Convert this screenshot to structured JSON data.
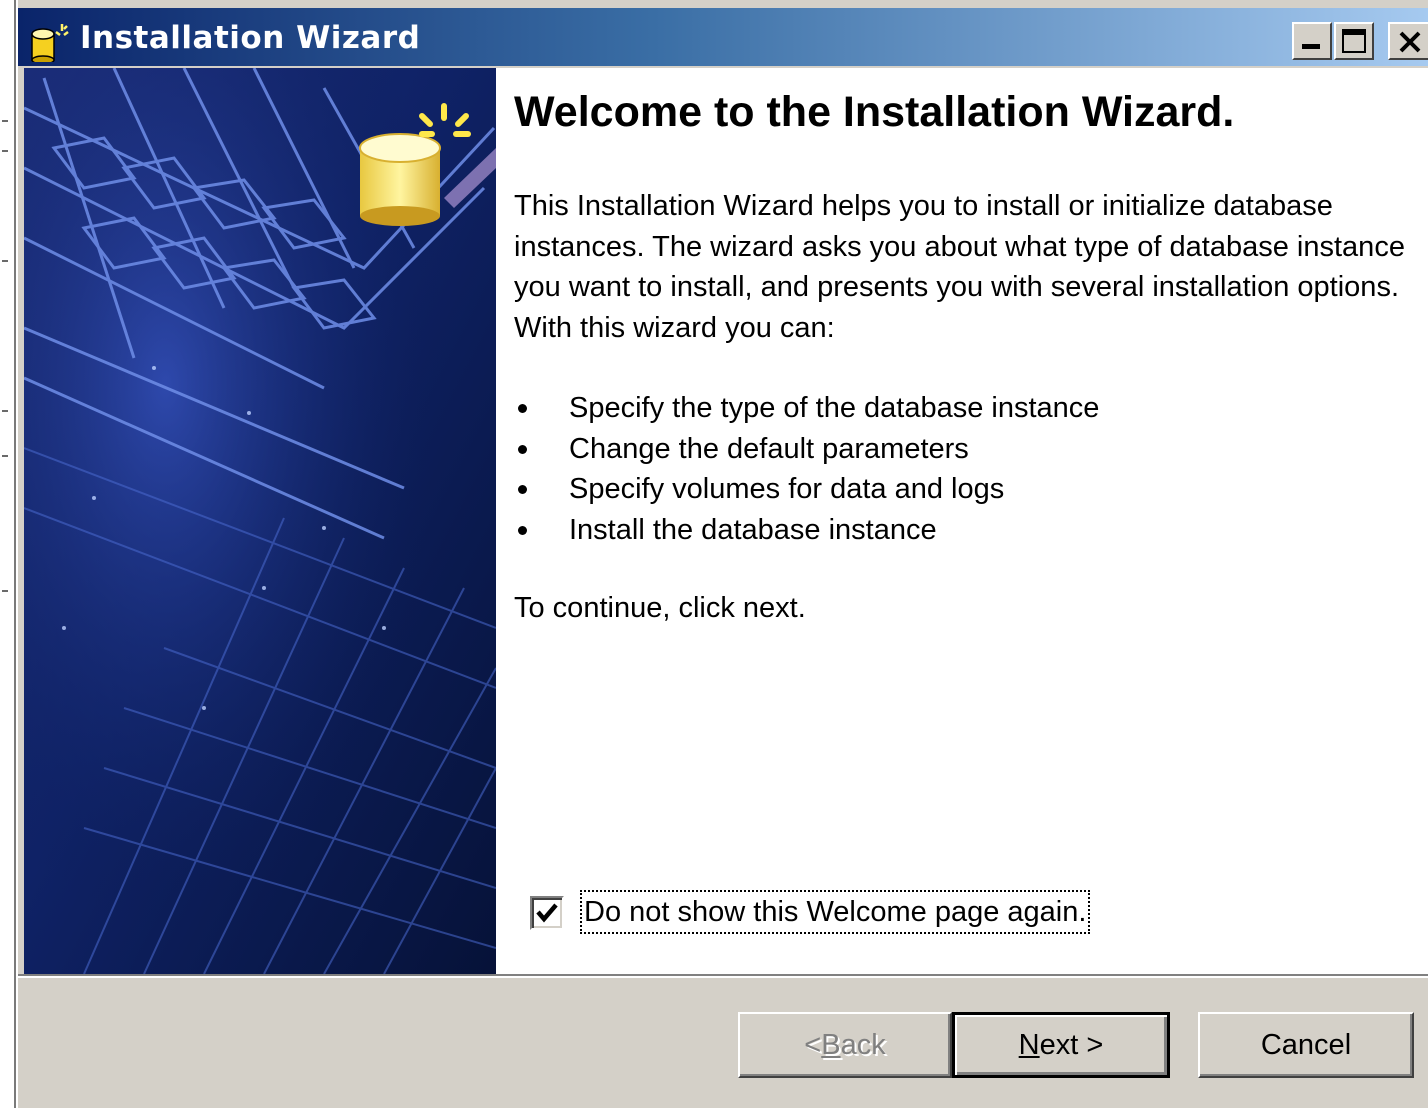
{
  "window": {
    "title": "Installation Wizard",
    "controls": {
      "minimize_icon": "minimize-icon",
      "maximize_icon": "maximize-icon",
      "close_icon": "close-icon"
    }
  },
  "banner": {
    "image": "wizard-banner-database-keyboard",
    "icon": "database-cylinder-icon"
  },
  "content": {
    "heading": "Welcome to the Installation Wizard.",
    "intro": "This Installation Wizard helps you to install or initialize database instances. The wizard asks you about what type of database instance you want to install, and presents you with several installation options. With this wizard you can:",
    "bullets": [
      "Specify the type of the database instance",
      "Change the default parameters",
      "Specify volumes for data and logs",
      "Install the database instance"
    ],
    "continue_text": "To continue, click next.",
    "dont_show_checkbox": {
      "label": "Do not show this Welcome page again.",
      "checked": true
    }
  },
  "buttons": {
    "back": {
      "prefix": "< ",
      "mnemonic": "B",
      "rest": "ack",
      "enabled": false
    },
    "next": {
      "mnemonic": "N",
      "rest": "ext >",
      "enabled": true,
      "default": true
    },
    "cancel": {
      "label": "Cancel",
      "enabled": true
    }
  },
  "colors": {
    "titlebar_start": "#0a246a",
    "titlebar_end": "#a6caf0",
    "dialog_face": "#d4d0c8",
    "banner_base": "#0d1f5c",
    "icon_yellow": "#ffe070"
  }
}
